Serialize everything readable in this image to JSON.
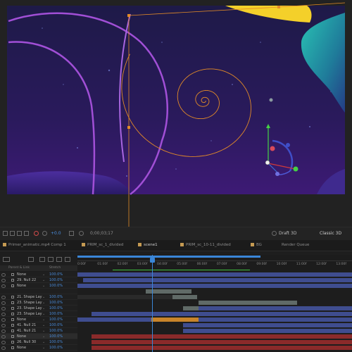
{
  "viewer_bar": {
    "fps_value": "+0.0",
    "timecode": "0;00;03;17",
    "renderer": "Draft 3D",
    "view_mode": "Classic 3D"
  },
  "tabs": [
    {
      "label": "Primer_animatic.mp4 Comp 1",
      "color": "#c59a52"
    },
    {
      "label": "PRIM_sc_1_divided",
      "color": "#c59a52"
    },
    {
      "label": "scene1",
      "color": "#c59a52",
      "active": true
    },
    {
      "label": "PRIM_sc_10-11_divided",
      "color": "#c59a52"
    },
    {
      "label": "BG",
      "color": "#c59a52"
    },
    {
      "label": "Render Queue",
      "color": ""
    }
  ],
  "columns": {
    "parent": "Parent & Link",
    "stretch": "Stretch"
  },
  "ruler": {
    "ticks": [
      "0:00f",
      "01:00f",
      "02:00f",
      "03:00f",
      "04:00f",
      "05:00f",
      "06:00f",
      "07:00f",
      "08:00f",
      "09:00f",
      "10:00f",
      "11:00f",
      "12:00f",
      "13:00f"
    ]
  },
  "layers": [
    {
      "name": "None",
      "opacity": "100.0%"
    },
    {
      "name": "29. Null 22",
      "opacity": "100.0%"
    },
    {
      "name": "None",
      "opacity": "100.0%"
    },
    {
      "name": "",
      "opacity": ""
    },
    {
      "name": "21. Shape Lay",
      "opacity": "100.0%"
    },
    {
      "name": "23. Shape Lay",
      "opacity": "100.0%"
    },
    {
      "name": "23. Shape Lay",
      "opacity": "100.0%"
    },
    {
      "name": "23. Shape Lay",
      "opacity": "100.0%"
    },
    {
      "name": "None",
      "opacity": "100.0%"
    },
    {
      "name": "41. Null 21",
      "opacity": "100.0%"
    },
    {
      "name": "41. Null 21",
      "opacity": "100.0%"
    },
    {
      "name": "None",
      "opacity": "100.0%"
    },
    {
      "name": "26. Null 30",
      "opacity": "100.0%"
    },
    {
      "name": "None",
      "opacity": "100.0%"
    }
  ],
  "colors": {
    "accent": "#3a86d8",
    "canvas_top": "#1b1b4a",
    "canvas_bottom": "#3a1a72",
    "spiral": "#e38b27",
    "arc": "#a14fd6",
    "yellow_shape": "#f4d02a",
    "teal_shape": "#27b3a6",
    "bar_blue": "#3f4d8f",
    "bar_grey": "#606a67",
    "bar_orange": "#c8842a",
    "bar_red": "#8a2a2a"
  }
}
